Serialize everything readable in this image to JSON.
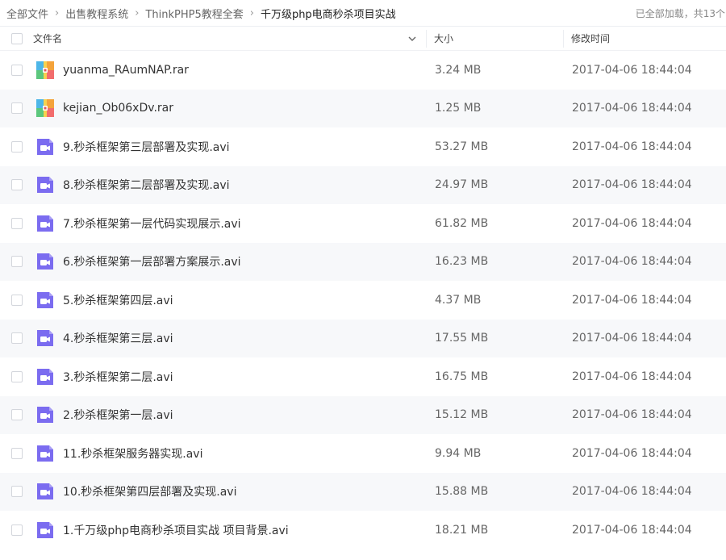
{
  "breadcrumb": {
    "items": [
      "全部文件",
      "出售教程系统",
      "ThinkPHP5教程全套",
      "千万级php电商秒杀项目实战"
    ],
    "status": "已全部加载，共13个"
  },
  "columns": {
    "name": "文件名",
    "size": "大小",
    "modified": "修改时间"
  },
  "files": [
    {
      "name": "yuanma_RAumNAP.rar",
      "size": "3.24 MB",
      "modified": "2017-04-06 18:44:04",
      "icon": "rar-icon"
    },
    {
      "name": "kejian_Ob06xDv.rar",
      "size": "1.25 MB",
      "modified": "2017-04-06 18:44:04",
      "icon": "rar-icon"
    },
    {
      "name": "9.秒杀框架第三层部署及实现.avi",
      "size": "53.27 MB",
      "modified": "2017-04-06 18:44:04",
      "icon": "video-icon"
    },
    {
      "name": "8.秒杀框架第二层部署及实现.avi",
      "size": "24.97 MB",
      "modified": "2017-04-06 18:44:04",
      "icon": "video-icon"
    },
    {
      "name": "7.秒杀框架第一层代码实现展示.avi",
      "size": "61.82 MB",
      "modified": "2017-04-06 18:44:04",
      "icon": "video-icon"
    },
    {
      "name": "6.秒杀框架第一层部署方案展示.avi",
      "size": "16.23 MB",
      "modified": "2017-04-06 18:44:04",
      "icon": "video-icon"
    },
    {
      "name": "5.秒杀框架第四层.avi",
      "size": "4.37 MB",
      "modified": "2017-04-06 18:44:04",
      "icon": "video-icon"
    },
    {
      "name": "4.秒杀框架第三层.avi",
      "size": "17.55 MB",
      "modified": "2017-04-06 18:44:04",
      "icon": "video-icon"
    },
    {
      "name": "3.秒杀框架第二层.avi",
      "size": "16.75 MB",
      "modified": "2017-04-06 18:44:04",
      "icon": "video-icon"
    },
    {
      "name": "2.秒杀框架第一层.avi",
      "size": "15.12 MB",
      "modified": "2017-04-06 18:44:04",
      "icon": "video-icon"
    },
    {
      "name": "11.秒杀框架服务器实现.avi",
      "size": "9.94 MB",
      "modified": "2017-04-06 18:44:04",
      "icon": "video-icon"
    },
    {
      "name": "10.秒杀框架第四层部署及实现.avi",
      "size": "15.88 MB",
      "modified": "2017-04-06 18:44:04",
      "icon": "video-icon"
    },
    {
      "name": "1.千万级php电商秒杀项目实战 项目背景.avi",
      "size": "18.21 MB",
      "modified": "2017-04-06 18:44:04",
      "icon": "video-icon"
    }
  ],
  "colors": {
    "video_icon": "#7b6cf0",
    "row_alt": "#f7f8fa",
    "text_primary": "#333333",
    "text_secondary": "#666666"
  }
}
